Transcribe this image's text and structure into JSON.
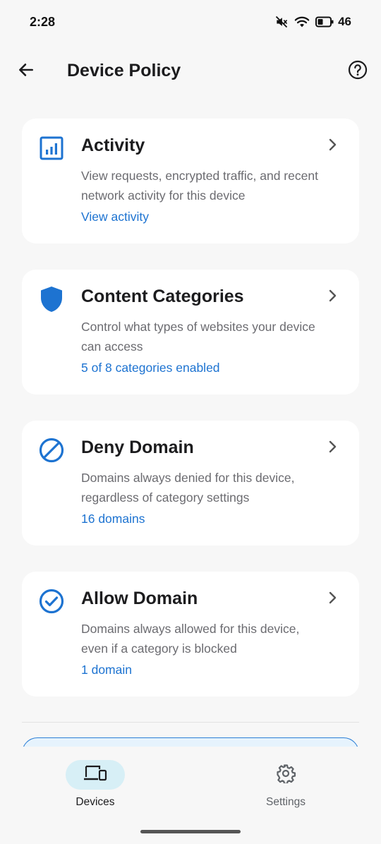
{
  "status_bar": {
    "time": "2:28",
    "battery_level": "46",
    "icons": [
      "mute-icon",
      "wifi-icon",
      "battery-icon"
    ]
  },
  "header": {
    "title": "Device Policy",
    "back_icon": "arrow-back-icon",
    "help_icon": "help-circle-icon"
  },
  "cards": [
    {
      "icon": "bar-chart-icon",
      "title": "Activity",
      "description": "View requests, encrypted traffic, and recent network activity for this device",
      "link": "View activity"
    },
    {
      "icon": "shield-icon",
      "title": "Content Categories",
      "description": "Control what types of websites your device can access",
      "link": "5 of 8 categories enabled"
    },
    {
      "icon": "block-icon",
      "title": "Deny Domain",
      "description": "Domains always denied for this device, regardless of category settings",
      "link": "16 domains"
    },
    {
      "icon": "check-circle-icon",
      "title": "Allow Domain",
      "description": "Domains always allowed for this device, even if a category is blocked",
      "link": "1 domain"
    }
  ],
  "bottom_nav": {
    "items": [
      {
        "label": "Devices",
        "icon": "devices-icon",
        "active": true
      },
      {
        "label": "Settings",
        "icon": "gear-icon",
        "active": false
      }
    ]
  },
  "colors": {
    "accent": "#1d73d1",
    "background": "#f7f7f7",
    "card": "#ffffff",
    "nav_active_pill": "#d7eff6"
  }
}
